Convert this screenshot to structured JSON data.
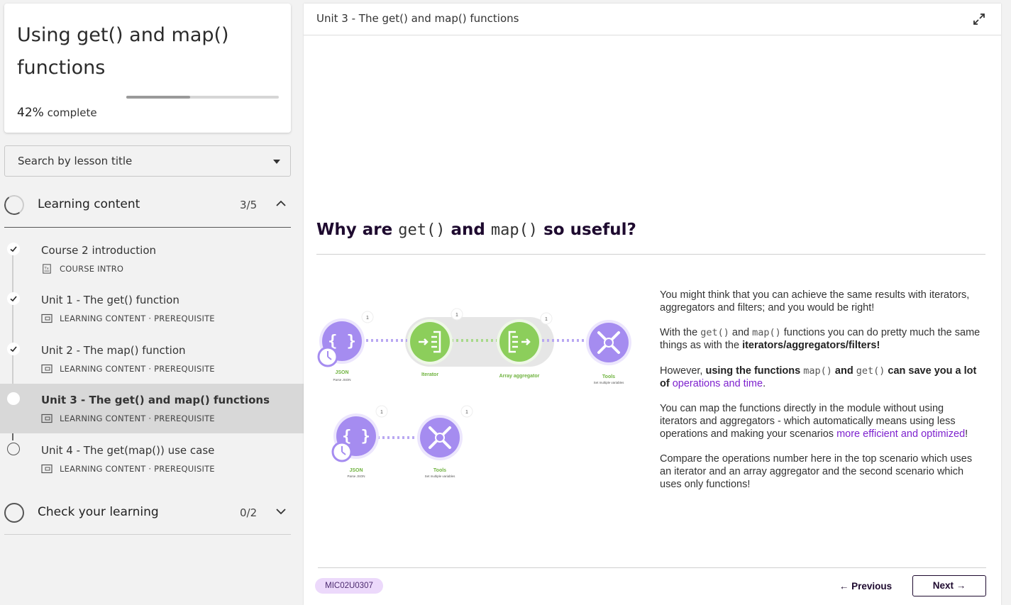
{
  "course": {
    "title": "Using get() and map() functions",
    "progress_percent": 42,
    "progress_value": "42%",
    "progress_suffix": " complete"
  },
  "search": {
    "placeholder": "Search by lesson title"
  },
  "sections": [
    {
      "title": "Learning content",
      "count": "3/5",
      "expanded": true,
      "lessons": [
        {
          "title": "Course 2 introduction",
          "meta": "COURSE INTRO",
          "status": "done",
          "icon": "course-intro-icon"
        },
        {
          "title": "Unit 1 - The get() function",
          "meta": "LEARNING CONTENT · PREREQUISITE",
          "status": "done",
          "icon": "learning-content-icon"
        },
        {
          "title": "Unit 2 - The map() function",
          "meta": "LEARNING CONTENT · PREREQUISITE",
          "status": "done",
          "icon": "learning-content-icon"
        },
        {
          "title": "Unit 3 - The get() and map() functions",
          "meta": "LEARNING CONTENT · PREREQUISITE",
          "status": "current",
          "icon": "learning-content-icon"
        },
        {
          "title": "Unit 4 - The get(map()) use case",
          "meta": "LEARNING CONTENT · PREREQUISITE",
          "status": "todo",
          "icon": "learning-content-icon"
        }
      ]
    },
    {
      "title": "Check your learning",
      "count": "0/2",
      "expanded": false
    }
  ],
  "main": {
    "header_title": "Unit 3 - The get() and map() functions",
    "heading": {
      "pre": "Why are ",
      "code1": "get()",
      "mid": " and ",
      "code2": "map()",
      "post": " so useful?"
    },
    "paragraphs": {
      "p1": "You might think that you can achieve the same results with iterators, aggregators and filters; and you would be right!",
      "p2_a": "With the ",
      "p2_code1": "get()",
      "p2_b": " and ",
      "p2_code2": "map()",
      "p2_c": " functions you can do pretty much the same things as with the ",
      "p2_bold": "iterators/aggregators/filters!",
      "p3_a": "However, ",
      "p3_bold1": "using the functions ",
      "p3_code1": "map()",
      "p3_bold2": " and ",
      "p3_code2": "get()",
      "p3_bold3": " can save you a lot of ",
      "p3_purple": "operations and time",
      "p3_end": ".",
      "p4_a": "You can map the functions directly in the module without using iterators and aggregators - which automatically means using less operations and making your scenarios ",
      "p4_purple": "more efficient and optimized",
      "p4_end": "!",
      "p5": "Compare the operations number here in the top scenario which uses an iterator and an array aggregator and the second scenario which uses only functions!"
    },
    "diagram": {
      "row1": [
        {
          "label": "JSON",
          "sub": "Parse JSON",
          "badge": "1",
          "icon": "json-braces-icon"
        },
        {
          "label": "Iterator",
          "sub": "",
          "badge": "1",
          "icon": "iterator-icon"
        },
        {
          "label": "Array aggregator",
          "sub": "",
          "badge": "1",
          "icon": "array-aggregator-icon"
        },
        {
          "label": "Tools",
          "sub": "Set multiple variables",
          "badge": "1",
          "icon": "tools-icon"
        }
      ],
      "row2": [
        {
          "label": "JSON",
          "sub": "Parse JSON",
          "badge": "1",
          "icon": "json-braces-icon"
        },
        {
          "label": "Tools",
          "sub": "Set multiple variables",
          "badge": "1",
          "icon": "tools-icon"
        }
      ],
      "colors": {
        "purple": "#a58cf0",
        "green": "#8cce5b",
        "label_green": "#6fb33f"
      }
    },
    "code_badge": "MIC02U0307",
    "prev_label": "← Previous",
    "next_label": "Next →"
  }
}
